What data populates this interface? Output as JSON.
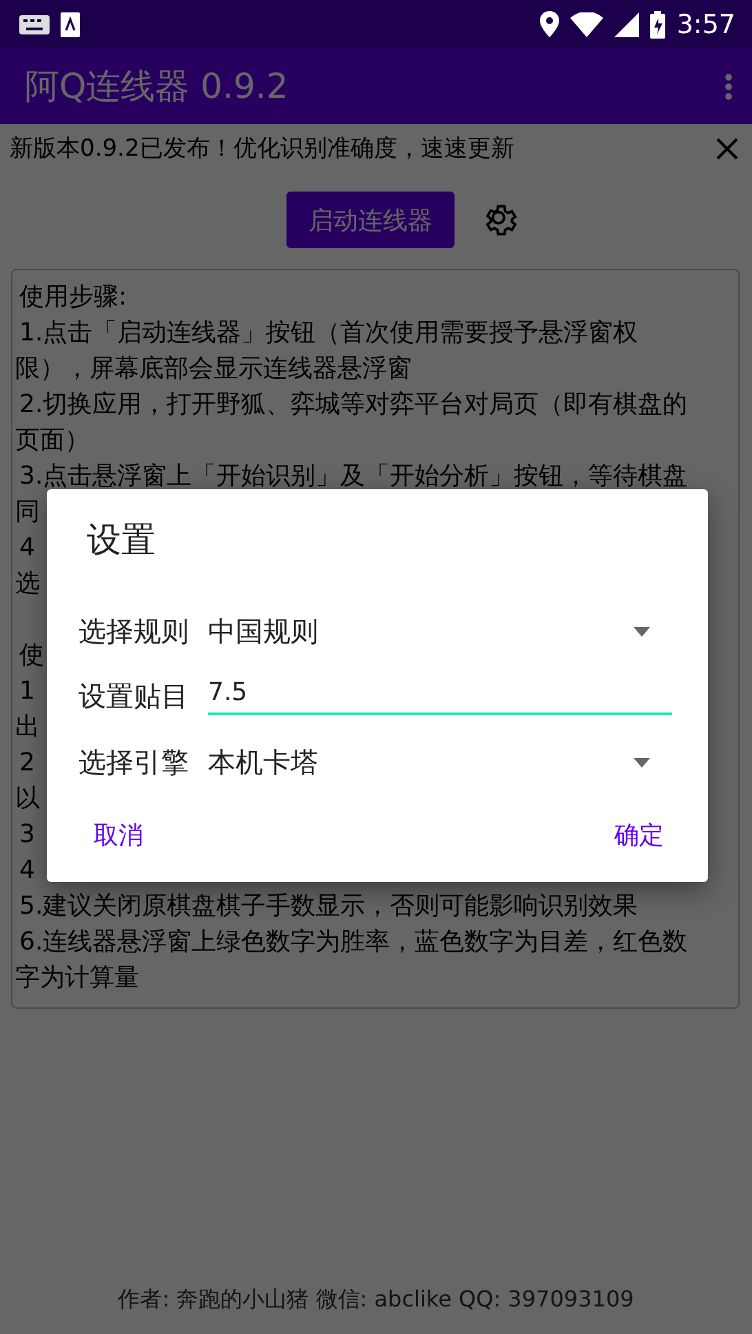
{
  "status_bar": {
    "time": "3:57"
  },
  "app_bar": {
    "title": "阿Q连线器 0.9.2"
  },
  "banner": {
    "text": "新版本0.9.2已发布！优化识别准确度，速速更新"
  },
  "start_button": {
    "label": "启动连线器"
  },
  "instructions": {
    "sections": [
      {
        "lines": [
          {
            "kind": "start",
            "text": "使用步骤:"
          },
          {
            "kind": "start",
            "text": "1.点击「启动连线器」按钮（首次使用需要授予悬浮窗权"
          },
          {
            "kind": "cont",
            "text": "限），屏幕底部会显示连线器悬浮窗"
          },
          {
            "kind": "start",
            "text": "2.切换应用，打开野狐、弈城等对弈平台对局页（即有棋盘的"
          },
          {
            "kind": "cont",
            "text": "页面）"
          },
          {
            "kind": "start",
            "text": "3.点击悬浮窗上「开始识别」及「开始分析」按钮，等待棋盘"
          },
          {
            "kind": "cont",
            "text": "同"
          },
          {
            "kind": "start",
            "text": "4"
          },
          {
            "kind": "cont",
            "text": "选"
          }
        ]
      },
      {
        "lines": [
          {
            "kind": "start",
            "text": "使"
          },
          {
            "kind": "start",
            "text": "1"
          },
          {
            "kind": "cont",
            "text": "出"
          },
          {
            "kind": "start",
            "text": "2"
          },
          {
            "kind": "cont",
            "text": "以"
          },
          {
            "kind": "start",
            "text": "3"
          },
          {
            "kind": "start",
            "text": "4"
          },
          {
            "kind": "start",
            "text": "5.建议关闭原棋盘棋子手数显示，否则可能影响识别效果"
          },
          {
            "kind": "start",
            "text": "6.连线器悬浮窗上绿色数字为胜率，蓝色数字为目差，红色数"
          },
          {
            "kind": "cont",
            "text": "字为计算量"
          }
        ]
      }
    ]
  },
  "footer": "作者: 奔跑的小山猪 微信: abclike QQ: 397093109",
  "dialog": {
    "title": "设置",
    "fields": [
      {
        "kind": "select",
        "label": "选择规则",
        "value": "中国规则"
      },
      {
        "kind": "input",
        "label": "设置贴目",
        "value": "7.5",
        "focused": true
      },
      {
        "kind": "select",
        "label": "选择引擎",
        "value": "本机卡塔"
      }
    ],
    "buttons": [
      {
        "label": "取消"
      },
      {
        "label": "确定"
      }
    ]
  }
}
